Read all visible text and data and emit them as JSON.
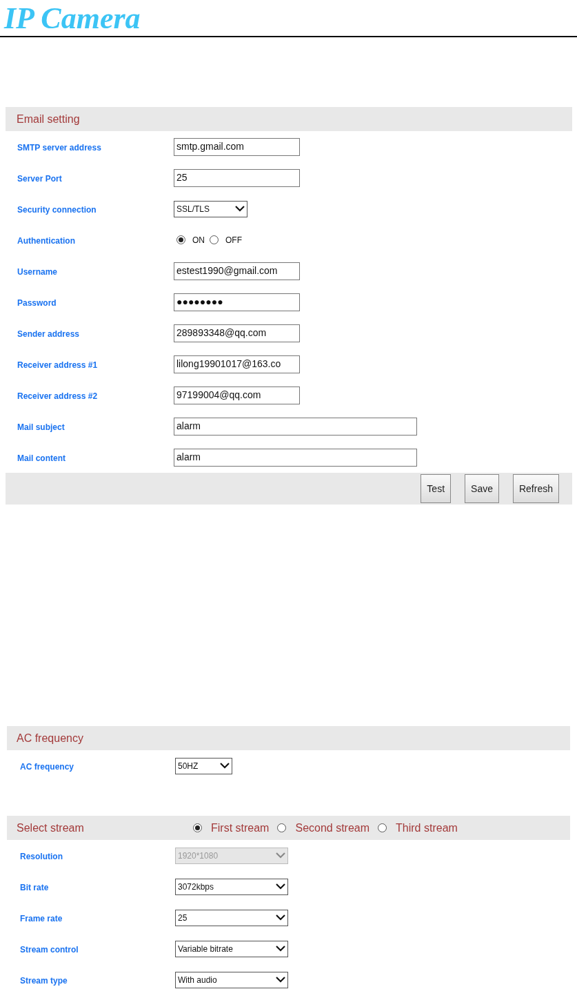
{
  "logo": "IP Camera",
  "email_setting": {
    "title": "Email setting",
    "fields": [
      {
        "kind": "text",
        "label": "SMTP server address",
        "value": "smtp.gmail.com"
      },
      {
        "kind": "text",
        "label": "Server Port",
        "value": "25"
      },
      {
        "kind": "select",
        "label": "Security connection",
        "value": "SSL/TLS"
      },
      {
        "kind": "radio",
        "label": "Authentication",
        "options": [
          {
            "label": "ON",
            "selected": true
          },
          {
            "label": "OFF",
            "selected": false
          }
        ]
      },
      {
        "kind": "text",
        "label": "Username",
        "value": "estest1990@gmail.com"
      },
      {
        "kind": "text",
        "label": "Password",
        "value": "●●●●●●●●"
      },
      {
        "kind": "text",
        "label": "Sender address",
        "value": "289893348@qq.com"
      },
      {
        "kind": "text",
        "label": "Receiver address #1",
        "value": "lilong19901017@163.co"
      },
      {
        "kind": "text",
        "label": "Receiver address #2",
        "value": "97199004@qq.com"
      },
      {
        "kind": "long_text",
        "label": "Mail subject",
        "value": "alarm"
      },
      {
        "kind": "long_text",
        "label": "Mail content",
        "value": "alarm"
      }
    ],
    "buttons": [
      "Test",
      "Save",
      "Refresh"
    ]
  },
  "ac_frequency": {
    "title": "AC frequency",
    "fields": [
      {
        "kind": "select",
        "label": "AC frequency",
        "value": "50HZ"
      }
    ]
  },
  "stream": {
    "title": "Select stream",
    "options": [
      {
        "label": "First stream",
        "selected": true
      },
      {
        "label": "Second stream",
        "selected": false
      },
      {
        "label": "Third stream",
        "selected": false
      }
    ],
    "fields": [
      {
        "kind": "select",
        "label": "Resolution",
        "value": "1920*1080",
        "disabled": true
      },
      {
        "kind": "select",
        "label": "Bit rate",
        "value": "3072kbps",
        "disabled": false
      },
      {
        "kind": "select",
        "label": "Frame rate",
        "value": "25",
        "disabled": false
      },
      {
        "kind": "select",
        "label": "Stream control",
        "value": "Variable bitrate",
        "disabled": false
      },
      {
        "kind": "select",
        "label": "Stream type",
        "value": "With audio",
        "disabled": false
      }
    ]
  }
}
